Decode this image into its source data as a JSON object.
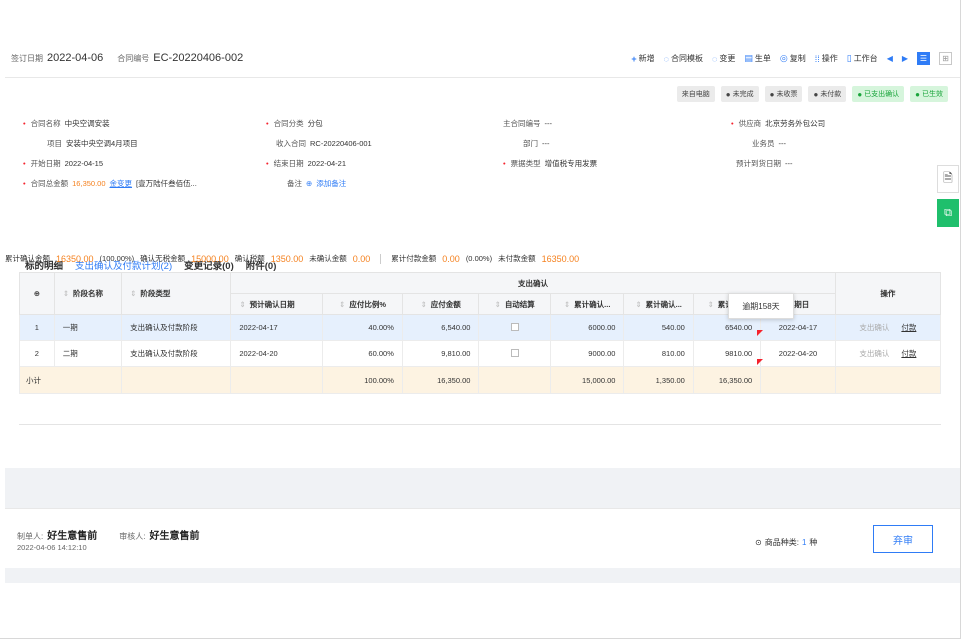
{
  "header": {
    "sign_date_label": "签订日期",
    "sign_date": "2022-04-06",
    "contract_no_label": "合同编号",
    "contract_no": "EC-20220406-002",
    "toolbar": [
      {
        "icon": "plus-icon",
        "label": "新增"
      },
      {
        "icon": "template-icon",
        "label": "合同模板"
      },
      {
        "icon": "change-icon",
        "label": "变更"
      },
      {
        "icon": "generate-icon",
        "label": "生单"
      },
      {
        "icon": "copy-icon",
        "label": "复制"
      },
      {
        "icon": "operate-icon",
        "label": "操作"
      },
      {
        "icon": "workbench-icon",
        "label": "工作台"
      }
    ]
  },
  "badges": [
    {
      "label": "来自电脑",
      "style": "plain"
    },
    {
      "label": "未完成",
      "style": "gray"
    },
    {
      "label": "未收票",
      "style": "gray"
    },
    {
      "label": "未付款",
      "style": "gray"
    },
    {
      "label": "已支出确认",
      "style": "green"
    },
    {
      "label": "已生效",
      "style": "green"
    }
  ],
  "fields": {
    "contract_name": {
      "label": "合同名称",
      "value": "中央空调安装"
    },
    "contract_category": {
      "label": "合同分类",
      "value": "分包"
    },
    "main_contract_no": {
      "label": "主合同编号",
      "value": "---"
    },
    "supplier": {
      "label": "供应商",
      "value": "北京劳务外包公司"
    },
    "project": {
      "label": "项目",
      "value": "安装中央空调4月项目"
    },
    "income_contract": {
      "label": "收入合同",
      "value": "RC-20220406-001"
    },
    "department": {
      "label": "部门",
      "value": "---"
    },
    "salesperson": {
      "label": "业务员",
      "value": "---"
    },
    "start_date": {
      "label": "开始日期",
      "value": "2022-04-15"
    },
    "end_date": {
      "label": "结束日期",
      "value": "2022-04-21"
    },
    "invoice_type": {
      "label": "票据类型",
      "value": "增值税专用发票"
    },
    "expected_arrival": {
      "label": "预计到货日期",
      "value": "---"
    },
    "total_amount": {
      "label": "合同总金额",
      "value": "16,350.00",
      "change_link": "金变更",
      "uppercase": "[壹万陆仟叁佰伍..."
    },
    "remark": {
      "label": "备注",
      "value": "添加备注"
    }
  },
  "tabs": [
    "标的明细",
    "支出确认及付款计划(2)",
    "变更记录(0)",
    "附件(0)"
  ],
  "summary": {
    "confirmed_label": "累计确认金额",
    "confirmed": "16350.00",
    "confirmed_pct": "(100.00%)",
    "untaxed_label": "确认无税金额",
    "untaxed": "15000.00",
    "tax_label": "确认税额",
    "tax": "1350.00",
    "unconfirmed_label": "未确认金额",
    "unconfirmed": "0.00",
    "paid_label": "累计付款金额",
    "paid": "0.00",
    "paid_pct": "(0.00%)",
    "unpaid_label": "未付款金额",
    "unpaid": "16350.00"
  },
  "table": {
    "group_header": "支出确认",
    "op_header": "操作",
    "index_header": "⊕",
    "columns": [
      "阶段名称",
      "阶段类型",
      "预计确认日期",
      "应付比例%",
      "应付金额",
      "自动结算",
      "累计确认...",
      "累计确认...",
      "累计确...",
      "到期日"
    ],
    "rows": [
      {
        "no": "1",
        "name": "一期",
        "type": "支出确认及付款阶段",
        "date": "2022-04-17",
        "ratio": "40.00%",
        "amount": "6,540.00",
        "c1": "6000.00",
        "c2": "540.00",
        "c3": "6540.00",
        "due": "2022-04-17",
        "op1": "支出确认",
        "op2": "付款"
      },
      {
        "no": "2",
        "name": "二期",
        "type": "支出确认及付款阶段",
        "date": "2022-04-20",
        "ratio": "60.00%",
        "amount": "9,810.00",
        "c1": "9000.00",
        "c2": "810.00",
        "c3": "9810.00",
        "due": "2022-04-20",
        "op1": "支出确认",
        "op2": "付款"
      }
    ],
    "subtotal": {
      "label": "小计",
      "ratio": "100.00%",
      "amount": "16,350.00",
      "c1": "15,000.00",
      "c2": "1,350.00",
      "c3": "16,350.00"
    }
  },
  "tooltip": "逾期158天",
  "footer": {
    "maker_label": "制单人:",
    "maker": "好生意售前",
    "reviewer_label": "审核人:",
    "reviewer": "好生意售前",
    "time": "2022-04-06 14:12:10",
    "kinds_label": "商品种类:",
    "kinds_value": "1",
    "kinds_unit": "种",
    "unreview_button": "弃审"
  },
  "colors": {
    "accent": "#2f7cf6",
    "orange": "#f58220",
    "red": "#f5222d",
    "green": "#1fbf6c"
  }
}
